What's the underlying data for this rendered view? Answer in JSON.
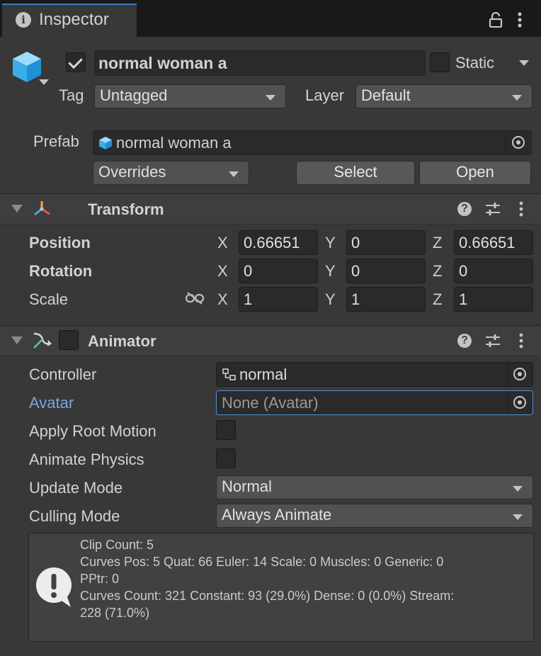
{
  "tab": {
    "title": "Inspector"
  },
  "header": {
    "name": "normal woman a",
    "static_label": "Static",
    "tag_label": "Tag",
    "tag_value": "Untagged",
    "layer_label": "Layer",
    "layer_value": "Default"
  },
  "prefab": {
    "label": "Prefab",
    "value": "normal woman a",
    "overrides": "Overrides",
    "select": "Select",
    "open": "Open"
  },
  "transform": {
    "title": "Transform",
    "rows": [
      {
        "label": "Position",
        "x": "0.66651",
        "y": "0",
        "z": "0.66651"
      },
      {
        "label": "Rotation",
        "x": "0",
        "y": "0",
        "z": "0"
      },
      {
        "label": "Scale",
        "x": "1",
        "y": "1",
        "z": "1"
      }
    ],
    "axis_x": "X",
    "axis_y": "Y",
    "axis_z": "Z"
  },
  "animator": {
    "title": "Animator",
    "controller_label": "Controller",
    "controller_value": "normal",
    "avatar_label": "Avatar",
    "avatar_value": "None (Avatar)",
    "apply_root_motion_label": "Apply Root Motion",
    "animate_physics_label": "Animate Physics",
    "update_mode_label": "Update Mode",
    "update_mode_value": "Normal",
    "culling_mode_label": "Culling Mode",
    "culling_mode_value": "Always Animate",
    "info_lines": [
      "Clip Count: 5",
      "Curves Pos: 5 Quat: 66 Euler: 14 Scale: 0 Muscles: 0 Generic: 0",
      "PPtr: 0",
      "Curves Count: 321 Constant: 93 (29.0%) Dense: 0 (0.0%) Stream:",
      "228 (71.0%)"
    ]
  },
  "colors": {
    "accent": "#4d8fd6",
    "avatar_label": "#7ba6e0",
    "background": "#383838"
  }
}
